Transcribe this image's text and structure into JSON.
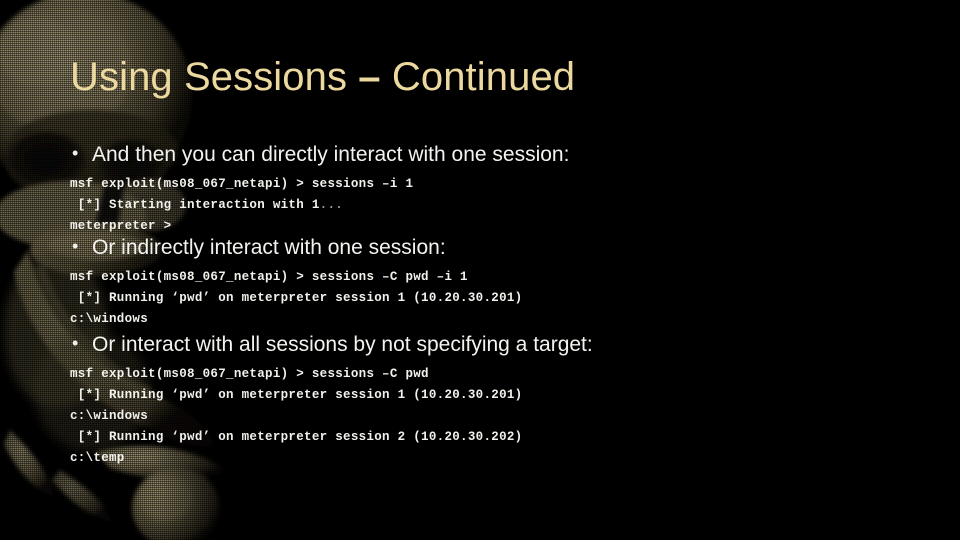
{
  "slide": {
    "title_main": "Using Sessions ",
    "title_dash": "–",
    "title_tail": " Continued",
    "background_art": "skull-halftone-image",
    "colors": {
      "background": "#000000",
      "title": "#ecd9a0",
      "bullet_text": "#f4f3ef",
      "code_text": "#f2f1ec",
      "art_highlight": "#a39874",
      "art_midtone": "#6d6348",
      "art_shadow": "#2a2518"
    }
  },
  "blocks": [
    {
      "bullet": "And then you can directly interact with one session:",
      "lines": [
        "msf exploit(ms08_067_netapi) > sessions –i 1",
        " [*] Starting interaction with 1",
        "meterpreter >"
      ],
      "line2_suffix": "..."
    },
    {
      "bullet": "Or indirectly interact with one session:",
      "lines": [
        "msf exploit(ms08_067_netapi) > sessions –C pwd –i 1",
        " [*] Running ‘pwd’ on meterpreter session 1 (10.20.30.201)",
        "c:\\windows"
      ]
    },
    {
      "bullet": "Or interact with all sessions by not specifying a target:",
      "lines": [
        "msf exploit(ms08_067_netapi) > sessions –C pwd",
        " [*] Running ‘pwd’ on meterpreter session 1 (10.20.30.201)",
        "c:\\windows",
        " [*] Running ‘pwd’ on meterpreter session 2 (10.20.30.202)",
        "c:\\temp"
      ]
    }
  ]
}
